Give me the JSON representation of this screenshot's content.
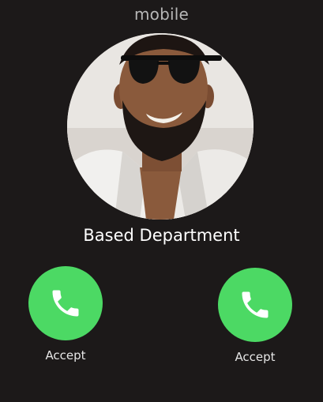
{
  "call": {
    "type_label": "mobile",
    "caller_name": "Based Department",
    "avatar_subject": "bearded man in sunglasses and white shirt"
  },
  "actions": [
    {
      "label": "Accept",
      "icon": "phone-icon",
      "color": "#4cd964"
    },
    {
      "label": "Accept",
      "icon": "phone-icon",
      "color": "#4cd964"
    }
  ],
  "colors": {
    "background": "#1c1919",
    "accept": "#4cd964",
    "secondary_text": "#b7b7b7"
  }
}
